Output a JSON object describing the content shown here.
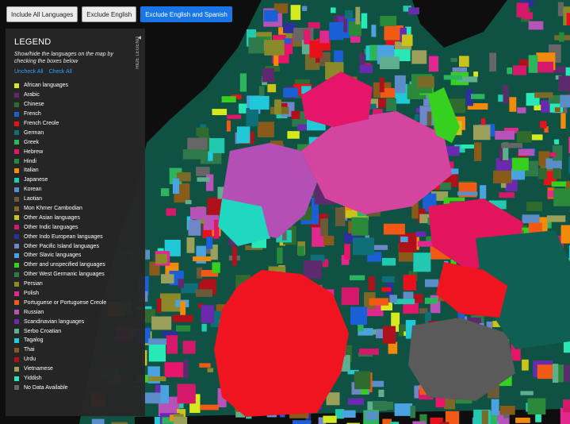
{
  "toolbar": {
    "buttons": [
      {
        "label": "Include All Languages",
        "active": false
      },
      {
        "label": "Exclude English",
        "active": false
      },
      {
        "label": "Exclude English and Spanish",
        "active": true
      }
    ]
  },
  "legend": {
    "title": "LEGEND",
    "subtitle": "Show/hide the languages on the map by checking the boxes below",
    "uncheck_all": "Uncheck All",
    "check_all": "Check All",
    "hide_label": "HIDE LEGEND",
    "items": [
      {
        "label": "African languages",
        "color": "#d6e81e"
      },
      {
        "label": "Arabic",
        "color": "#5d2a6e"
      },
      {
        "label": "Chinese",
        "color": "#2f6b2f"
      },
      {
        "label": "French",
        "color": "#1b5fd6"
      },
      {
        "label": "French Creole",
        "color": "#e8101a"
      },
      {
        "label": "German",
        "color": "#0f6f78"
      },
      {
        "label": "Greek",
        "color": "#2db55d"
      },
      {
        "label": "Hebrew",
        "color": "#e5156a"
      },
      {
        "label": "Hindi",
        "color": "#2a8a3a"
      },
      {
        "label": "Italian",
        "color": "#f28a0b"
      },
      {
        "label": "Japanese",
        "color": "#20c9b0"
      },
      {
        "label": "Korean",
        "color": "#5b8dc9"
      },
      {
        "label": "Laotian",
        "color": "#6b5a3a"
      },
      {
        "label": "Mon Khmer Cambodian",
        "color": "#7a6a2a"
      },
      {
        "label": "Other Asian languages",
        "color": "#c9c31a"
      },
      {
        "label": "Other Indic languages",
        "color": "#d4196b"
      },
      {
        "label": "Other Indo European languages",
        "color": "#2c2f9e"
      },
      {
        "label": "Other Pacific Island languages",
        "color": "#6f86c9"
      },
      {
        "label": "Other Slavic languages",
        "color": "#4aa3e0"
      },
      {
        "label": "Other and unspecified languages",
        "color": "#35d11e"
      },
      {
        "label": "Other West Germanic languages",
        "color": "#2e7a4a"
      },
      {
        "label": "Persian",
        "color": "#8a8a2a"
      },
      {
        "label": "Polish",
        "color": "#e0288f"
      },
      {
        "label": "Portuguese or Portuguese Creole",
        "color": "#f05a14"
      },
      {
        "label": "Russian",
        "color": "#b652b8"
      },
      {
        "label": "Scandinavian languages",
        "color": "#6a2ab0"
      },
      {
        "label": "Serbo Croatian",
        "color": "#5fae8e"
      },
      {
        "label": "Tagalog",
        "color": "#20c8d8"
      },
      {
        "label": "Thai",
        "color": "#8a5a1a"
      },
      {
        "label": "Urdu",
        "color": "#b0101a"
      },
      {
        "label": "Vietnamese",
        "color": "#9aa05a"
      },
      {
        "label": "Yiddish",
        "color": "#28e8b8"
      },
      {
        "label": "No Data Available",
        "color": "#666666"
      }
    ]
  },
  "map_colors": {
    "background": "#0f5244",
    "water": "#0e0e0e",
    "no_data": "#666666"
  }
}
